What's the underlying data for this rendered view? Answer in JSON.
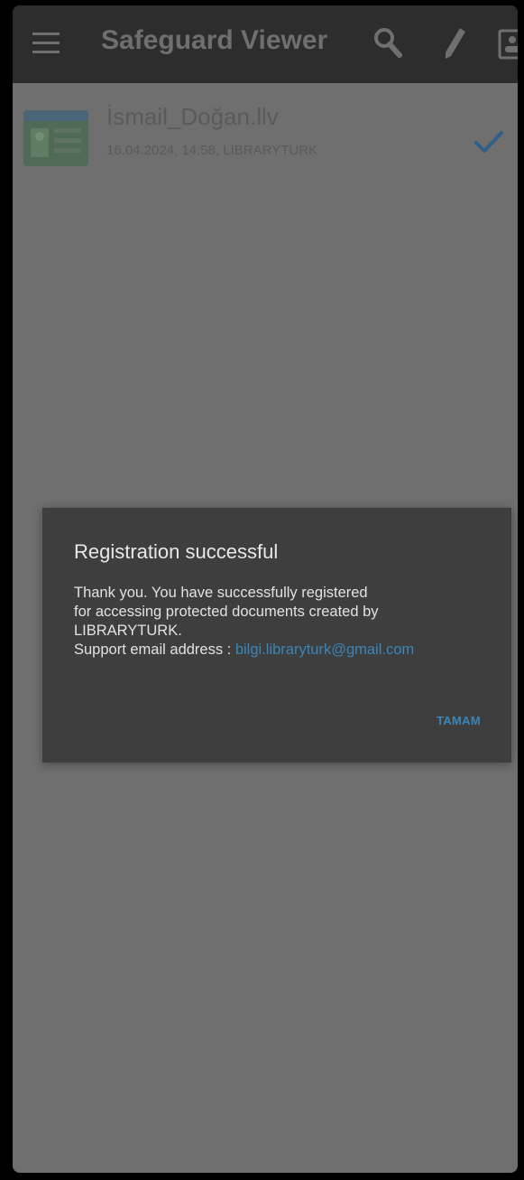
{
  "app": {
    "title": "Safeguard Viewer",
    "colors": {
      "appbar_bg": "#2d2d2d",
      "screen_bg": "#6f6f6f",
      "dialog_bg": "#3e3e3e",
      "link": "#3a86b8",
      "check": "#2f5f86"
    }
  },
  "toolbar": {
    "icons": [
      "menu-icon",
      "search-icon",
      "edit-icon",
      "account-icon"
    ]
  },
  "files": [
    {
      "name": "İsmail_Doğan.llv",
      "meta": "16.04.2024, 14:58, LIBRARYTURK",
      "icon": "document-card-icon",
      "checked": true
    }
  ],
  "dialog": {
    "title": "Registration successful",
    "line1": "Thank you. You have successfully registered",
    "line2": "for accessing protected documents created by",
    "line3": "LIBRARYTURK.",
    "support_label": "Support email address : ",
    "support_email": "bilgi.libraryturk@gmail.com",
    "ok_label": "TAMAM"
  }
}
